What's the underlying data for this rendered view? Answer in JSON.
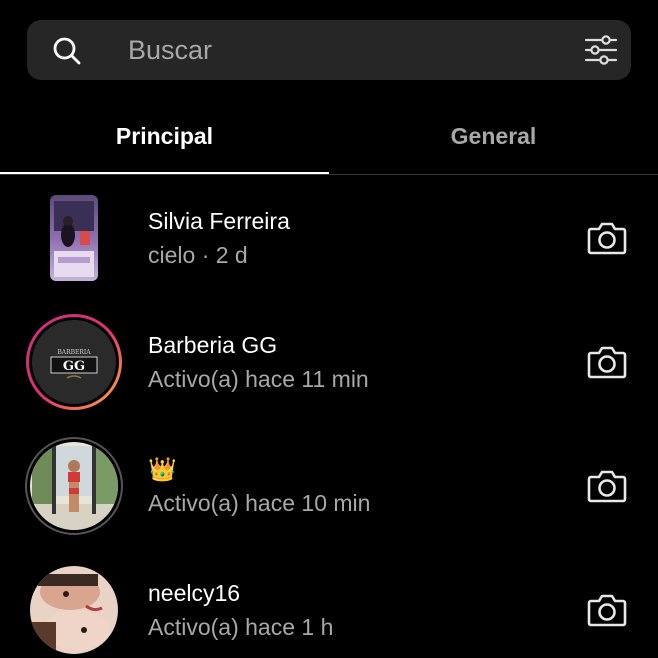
{
  "search": {
    "placeholder": "Buscar",
    "icon": "search-icon",
    "filter_icon": "filter-icon"
  },
  "tabs": [
    {
      "label": "Principal",
      "selected": true
    },
    {
      "label": "General",
      "selected": false
    }
  ],
  "conversations": [
    {
      "name": "Silvia Ferreira",
      "status": "cielo · 2 d",
      "action_icon": "camera-icon"
    },
    {
      "name": "Barberia GG",
      "status": "Activo(a) hace 11 min",
      "action_icon": "camera-icon",
      "avatar_text": "GG",
      "avatar_subtext": "BARBERIA",
      "story_ring": true
    },
    {
      "name": "👑",
      "status": "Activo(a) hace 10 min",
      "action_icon": "camera-icon"
    },
    {
      "name": "neelcy16",
      "status": "Activo(a) hace 1 h",
      "action_icon": "camera-icon"
    }
  ],
  "colors": {
    "background": "#000000",
    "search_bg": "#262626",
    "secondary_text": "#a8a8a8",
    "primary_text": "#ffffff",
    "story_ring_start": "#d62976",
    "story_ring_end": "#fa7e1e"
  }
}
